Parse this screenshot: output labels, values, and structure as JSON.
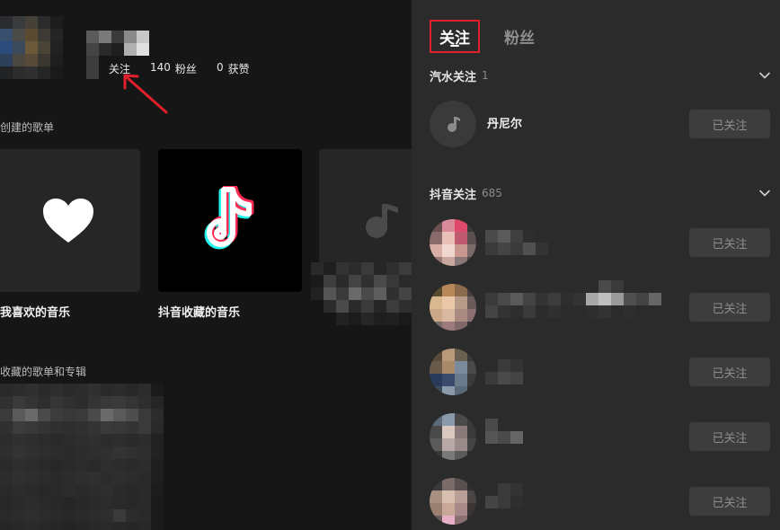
{
  "profile": {
    "follow_label": "关注",
    "fans_count": "140",
    "fans_label": "粉丝",
    "likes_count": "0",
    "likes_label": "获赞"
  },
  "created_playlists": {
    "title": "创建的歌单",
    "cards": [
      {
        "label": "我喜欢的音乐",
        "icon": "heart-icon"
      },
      {
        "label": "抖音收藏的音乐",
        "icon": "tiktok-logo-icon"
      },
      {
        "label": "",
        "icon": "music-note-icon"
      }
    ]
  },
  "collected": {
    "title": "收藏的歌单和专辑"
  },
  "follow_panel": {
    "tabs": [
      {
        "label": "关注",
        "active": true
      },
      {
        "label": "粉丝",
        "active": false
      }
    ],
    "groups": [
      {
        "title": "汽水关注",
        "count": "1",
        "users": [
          {
            "name": "丹尼尔",
            "button": "已关注"
          }
        ]
      },
      {
        "title": "抖音关注",
        "count": "685",
        "users": [
          {
            "name": "",
            "button": "已关注"
          },
          {
            "name": "",
            "button": "已关注"
          },
          {
            "name": "",
            "button": "已关注"
          },
          {
            "name": "",
            "button": "已关注"
          },
          {
            "name": "",
            "button": "已关注"
          }
        ]
      }
    ]
  },
  "colors": {
    "accent_red": "#e0202a",
    "panel_bg": "#2b2b2b",
    "page_bg": "#161616",
    "button_bg": "#3d3d3d"
  }
}
